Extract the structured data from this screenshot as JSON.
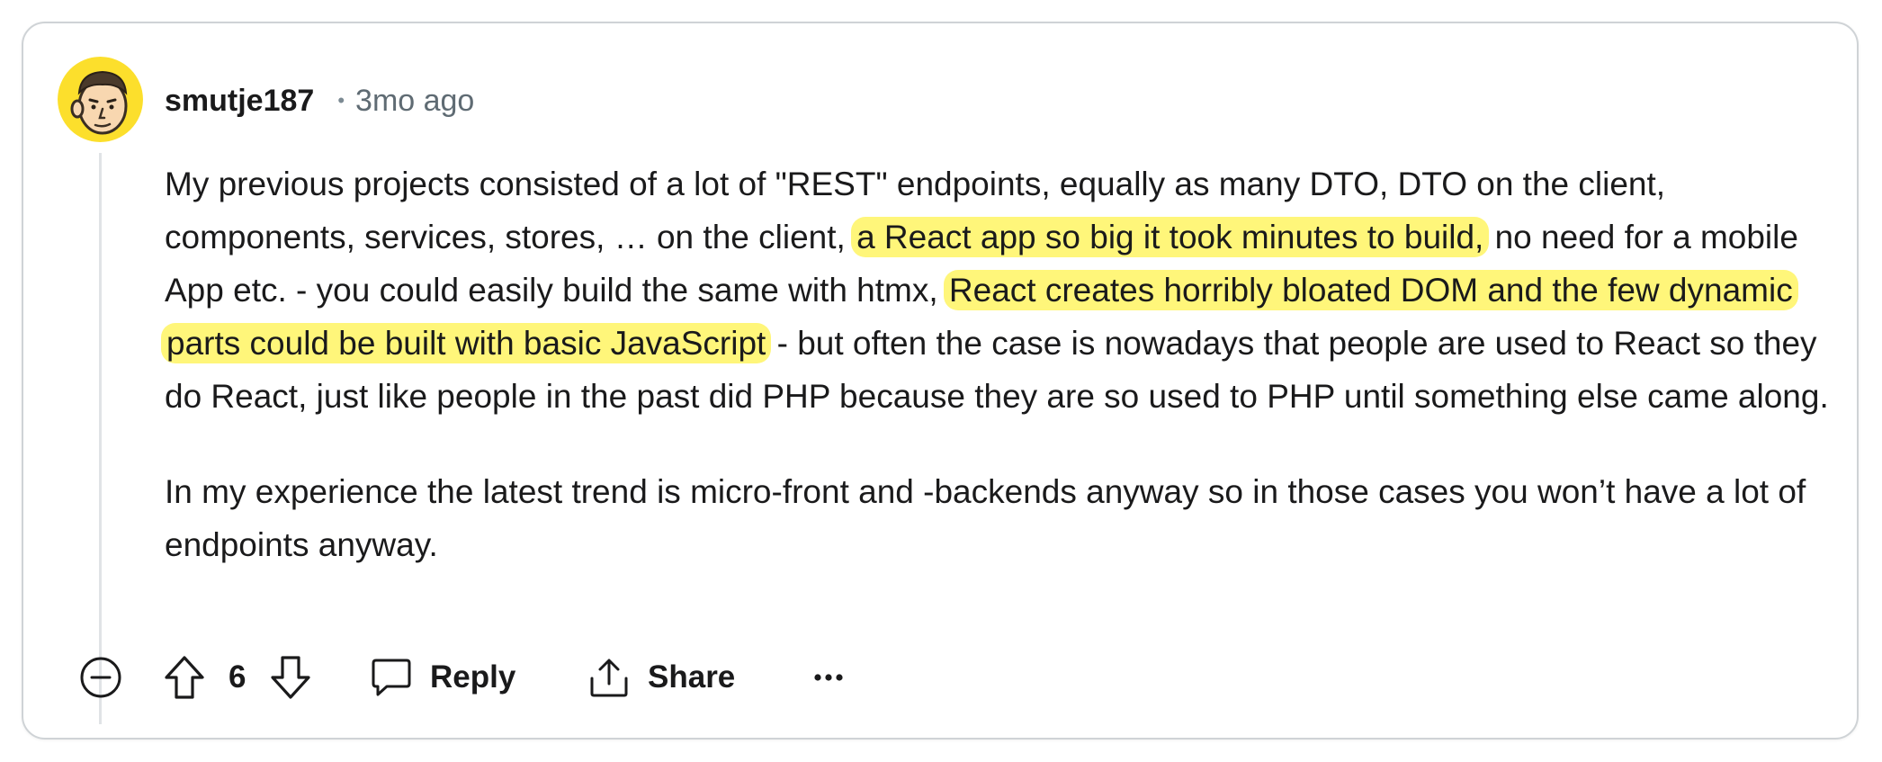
{
  "comment": {
    "username": "smutje187",
    "separator": "•",
    "timestamp": "3mo ago",
    "avatar_icon": "snoo-avatar-icon",
    "paragraphs": [
      {
        "segments": [
          {
            "text": "My previous projects consisted of a lot of \"REST\" endpoints, equally as many DTO, DTO on the client, components, services, stores, … on the client, ",
            "highlight": false
          },
          {
            "text": "a React app so big it took minutes to build,",
            "highlight": true
          },
          {
            "text": " no need for a mobile App etc. - you could easily build the same with htmx, ",
            "highlight": false
          },
          {
            "text": "React creates horribly bloated DOM and the few dynamic parts could be built with basic JavaScript",
            "highlight": true
          },
          {
            "text": " - but often the case is nowadays that people are used to React so they do React, just like people in the past did PHP because they are so used to PHP until something else came along.",
            "highlight": false
          }
        ]
      },
      {
        "segments": [
          {
            "text": "In my experience the latest trend is micro-front and -backends anyway so in those cases you won’t have a lot of endpoints anyway.",
            "highlight": false
          }
        ]
      }
    ],
    "highlight_color": "#fff67a"
  },
  "actions": {
    "collapse_icon": "collapse-icon",
    "upvote_icon": "upvote-arrow-icon",
    "score": "6",
    "downvote_icon": "downvote-arrow-icon",
    "reply_label": "Reply",
    "reply_icon": "speech-bubble-icon",
    "share_label": "Share",
    "share_icon": "share-icon",
    "more_icon": "more-options-icon"
  }
}
